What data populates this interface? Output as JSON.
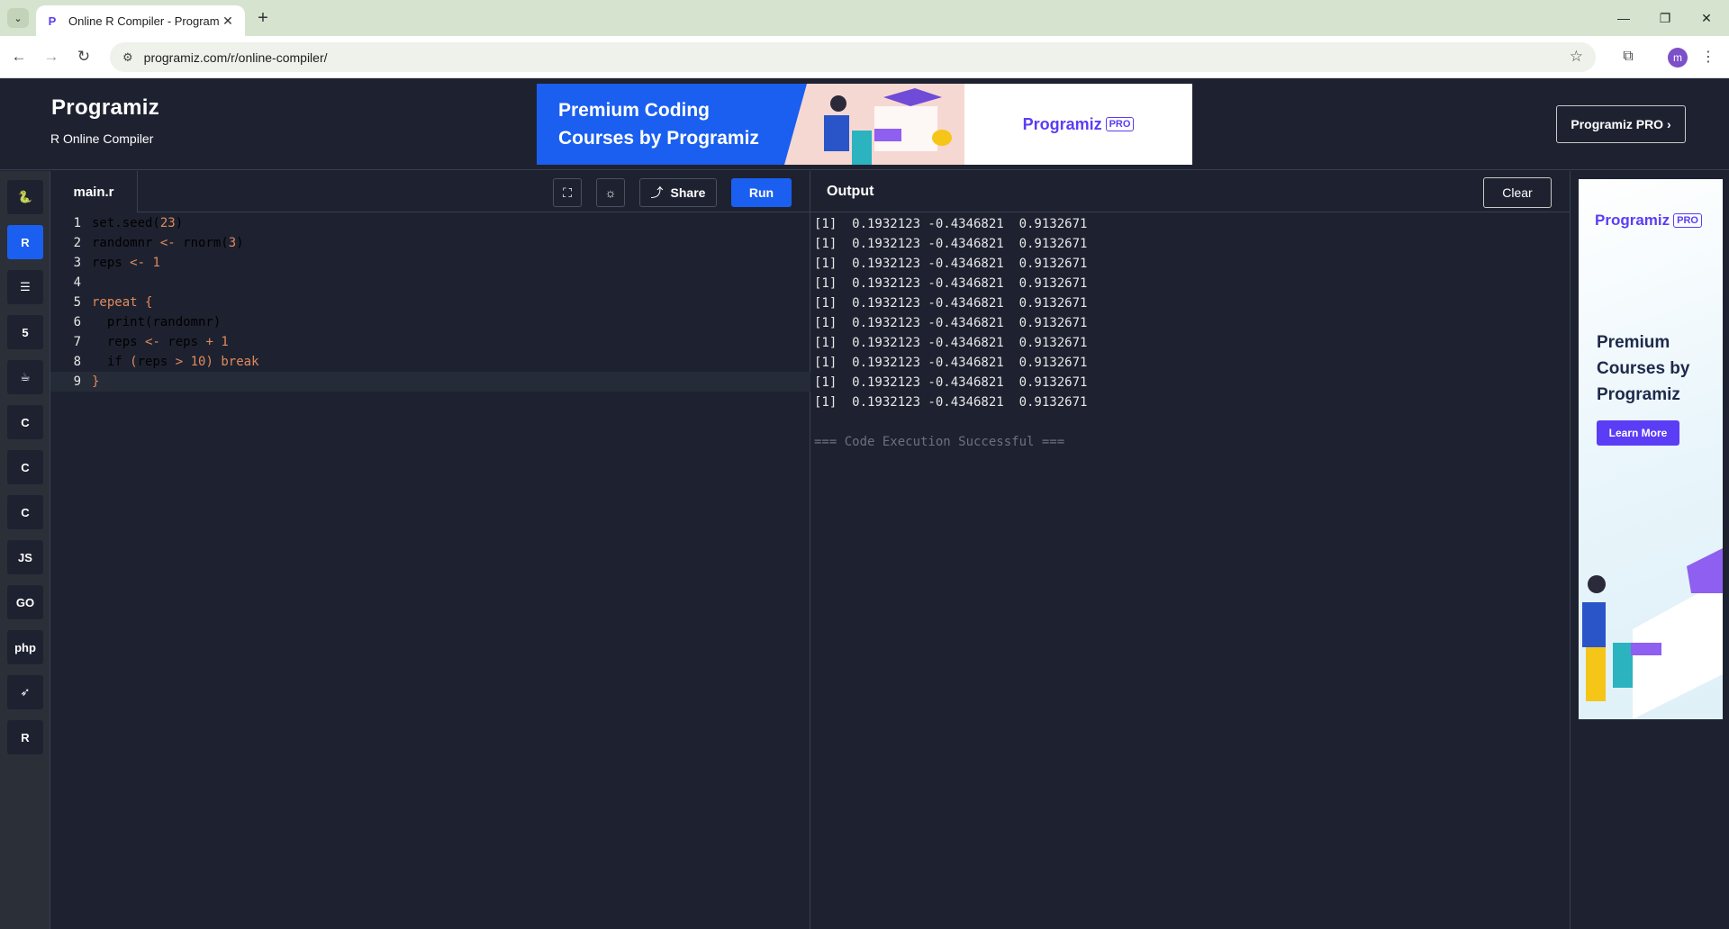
{
  "browser": {
    "tab_title": "Online R Compiler - Programiz",
    "tab_favicon": "P",
    "url": "programiz.com/r/online-compiler/",
    "profile_initial": "m"
  },
  "header": {
    "logo": "Programiz",
    "subtitle": "R Online Compiler",
    "ad_text": "Premium Coding Courses by Programiz",
    "ad_brand": "Programiz",
    "ad_brand_tag": "PRO",
    "pro_button": "Programiz PRO ›"
  },
  "sidebar": {
    "languages": [
      {
        "name": "python-icon",
        "glyph": "🐍"
      },
      {
        "name": "r-icon",
        "glyph": "R",
        "active": true
      },
      {
        "name": "sql-icon",
        "glyph": "☰"
      },
      {
        "name": "html-icon",
        "glyph": "5"
      },
      {
        "name": "java-icon",
        "glyph": "☕"
      },
      {
        "name": "c-icon",
        "glyph": "C"
      },
      {
        "name": "cpp-icon",
        "glyph": "C"
      },
      {
        "name": "csharp-icon",
        "glyph": "C"
      },
      {
        "name": "js-icon",
        "glyph": "JS"
      },
      {
        "name": "go-icon",
        "glyph": "GO"
      },
      {
        "name": "php-icon",
        "glyph": "php"
      },
      {
        "name": "swift-icon",
        "glyph": "➶"
      },
      {
        "name": "rust-icon",
        "glyph": "R"
      }
    ]
  },
  "editor": {
    "file_tab": "main.r",
    "share_label": "Share",
    "run_label": "Run",
    "lines": [
      [
        "1",
        "set.seed(23)"
      ],
      [
        "2",
        "randomnr <- rnorm(3)"
      ],
      [
        "3",
        "reps <- 1"
      ],
      [
        "4",
        ""
      ],
      [
        "5",
        "repeat {"
      ],
      [
        "6",
        "  print(randomnr)"
      ],
      [
        "7",
        "  reps <- reps + 1"
      ],
      [
        "8",
        "  if (reps > 10) break"
      ],
      [
        "9",
        "}"
      ]
    ]
  },
  "output": {
    "title": "Output",
    "clear_label": "Clear",
    "lines": [
      "[1]  0.1932123 -0.4346821  0.9132671",
      "[1]  0.1932123 -0.4346821  0.9132671",
      "[1]  0.1932123 -0.4346821  0.9132671",
      "[1]  0.1932123 -0.4346821  0.9132671",
      "[1]  0.1932123 -0.4346821  0.9132671",
      "[1]  0.1932123 -0.4346821  0.9132671",
      "[1]  0.1932123 -0.4346821  0.9132671",
      "[1]  0.1932123 -0.4346821  0.9132671",
      "[1]  0.1932123 -0.4346821  0.9132671",
      "[1]  0.1932123 -0.4346821  0.9132671"
    ],
    "status": "=== Code Execution Successful ==="
  },
  "side_ad": {
    "brand": "Programiz",
    "brand_tag": "PRO",
    "text": "Premium Courses by Programiz",
    "button": "Learn More"
  }
}
